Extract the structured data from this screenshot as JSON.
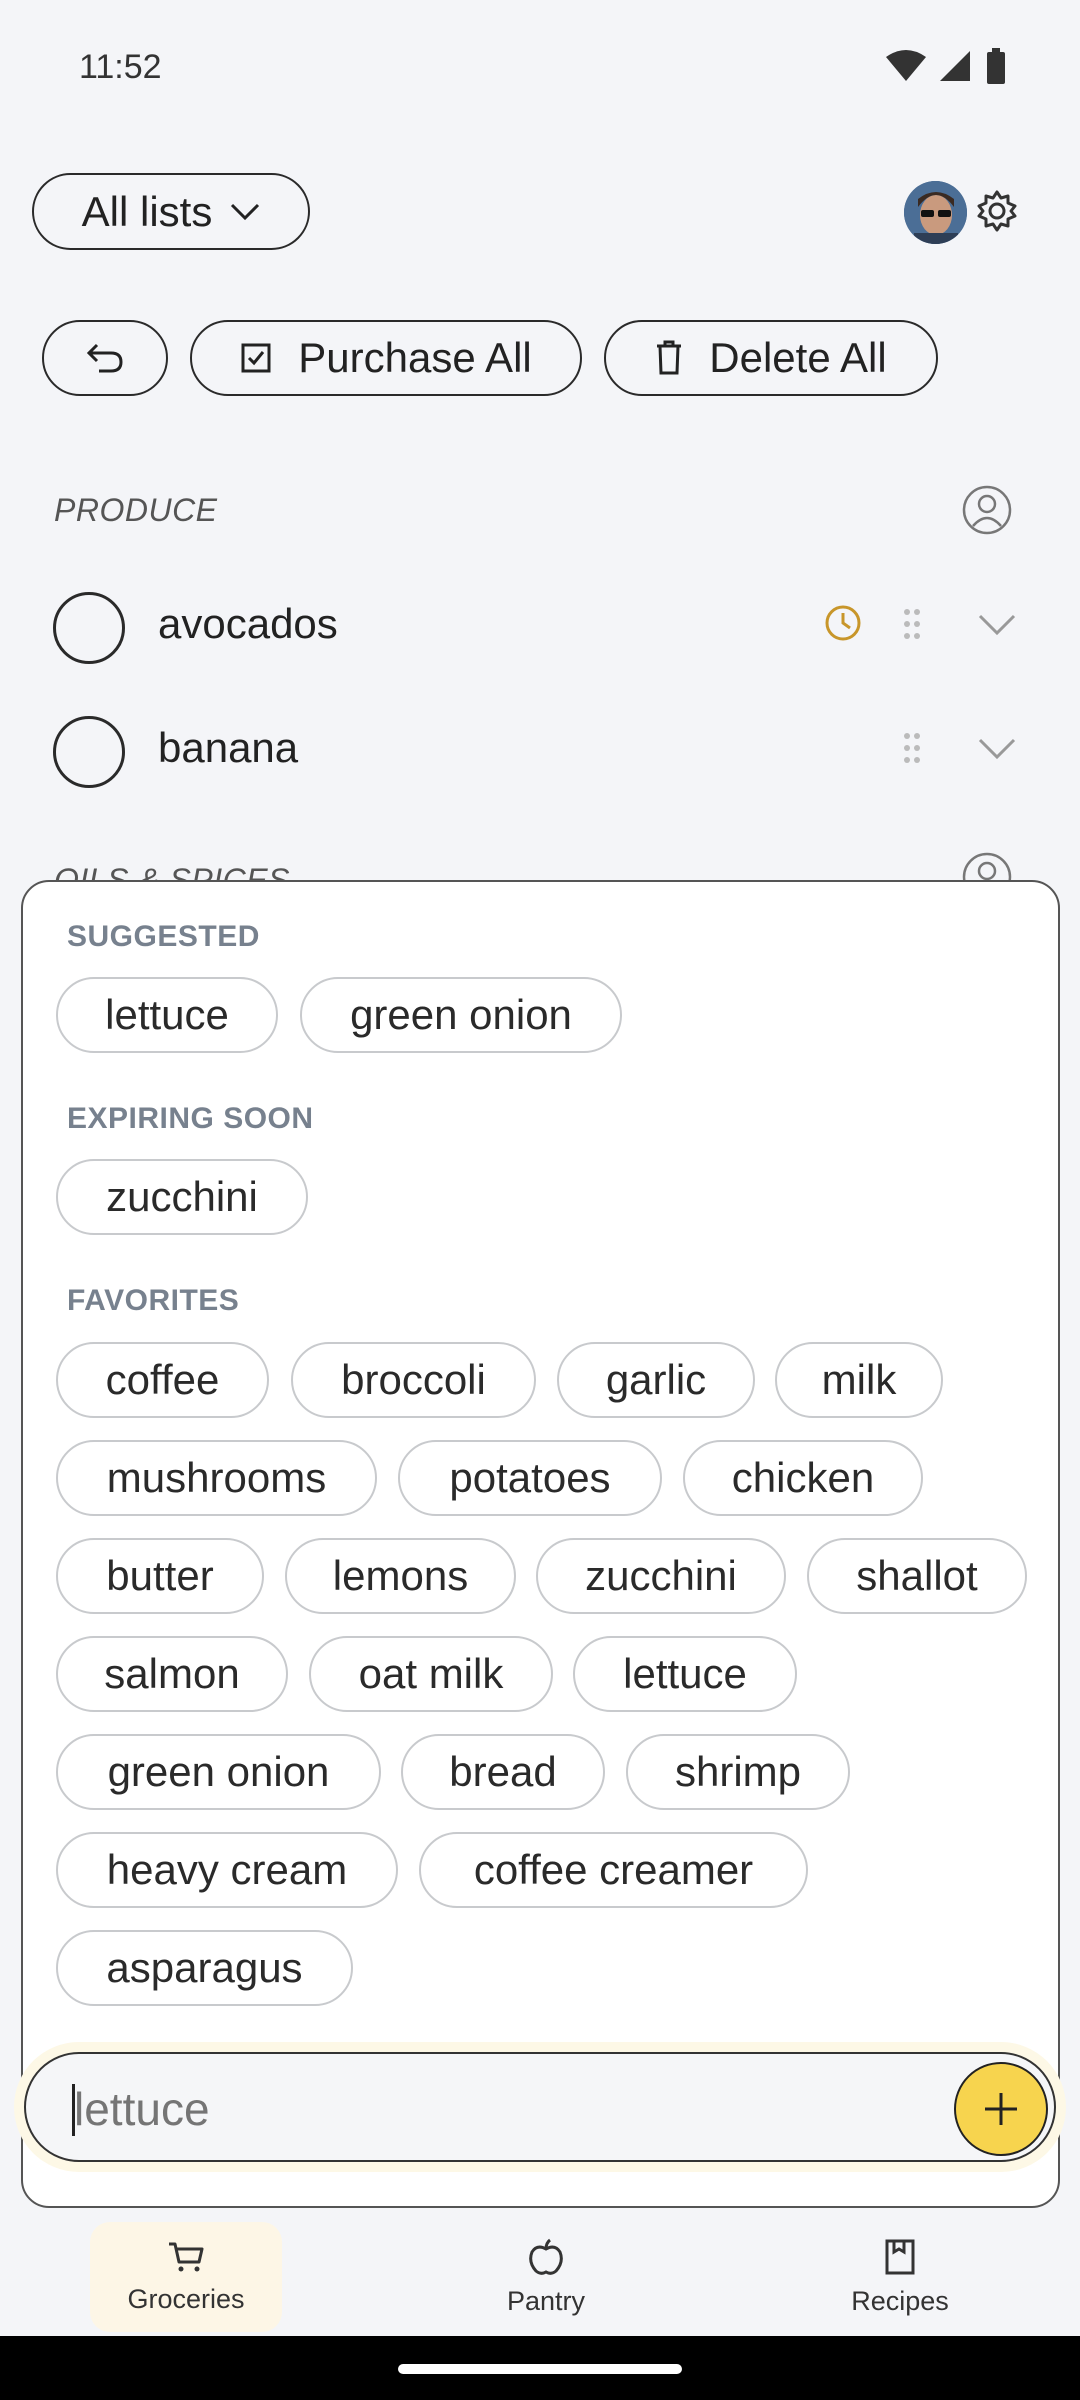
{
  "status": {
    "time": "11:52"
  },
  "header": {
    "list_selector": "All lists"
  },
  "actions": {
    "purchase_all": "Purchase All",
    "delete_all": "Delete All"
  },
  "sections": {
    "produce": {
      "title": "PRODUCE",
      "items": [
        {
          "name": "avocados",
          "expiring": true
        },
        {
          "name": "banana",
          "expiring": false
        }
      ]
    },
    "oils_spices": {
      "title": "OILS & SPICES"
    }
  },
  "sheet": {
    "suggested": {
      "heading": "SUGGESTED",
      "chips": [
        "lettuce",
        "green onion"
      ]
    },
    "expiring": {
      "heading": "EXPIRING SOON",
      "chips": [
        "zucchini"
      ]
    },
    "favorites": {
      "heading": "FAVORITES",
      "chips": [
        "coffee",
        "broccoli",
        "garlic",
        "milk",
        "mushrooms",
        "potatoes",
        "chicken",
        "butter",
        "lemons",
        "zucchini",
        "shallot",
        "salmon",
        "oat milk",
        "lettuce",
        "green onion",
        "bread",
        "shrimp",
        "heavy cream",
        "coffee creamer",
        "asparagus"
      ]
    }
  },
  "input": {
    "placeholder": "lettuce"
  },
  "nav": {
    "groceries": "Groceries",
    "pantry": "Pantry",
    "recipes": "Recipes"
  },
  "colors": {
    "accent": "#f7d44e",
    "clock": "#c8962a",
    "nav_active": "#fdf6e6"
  }
}
